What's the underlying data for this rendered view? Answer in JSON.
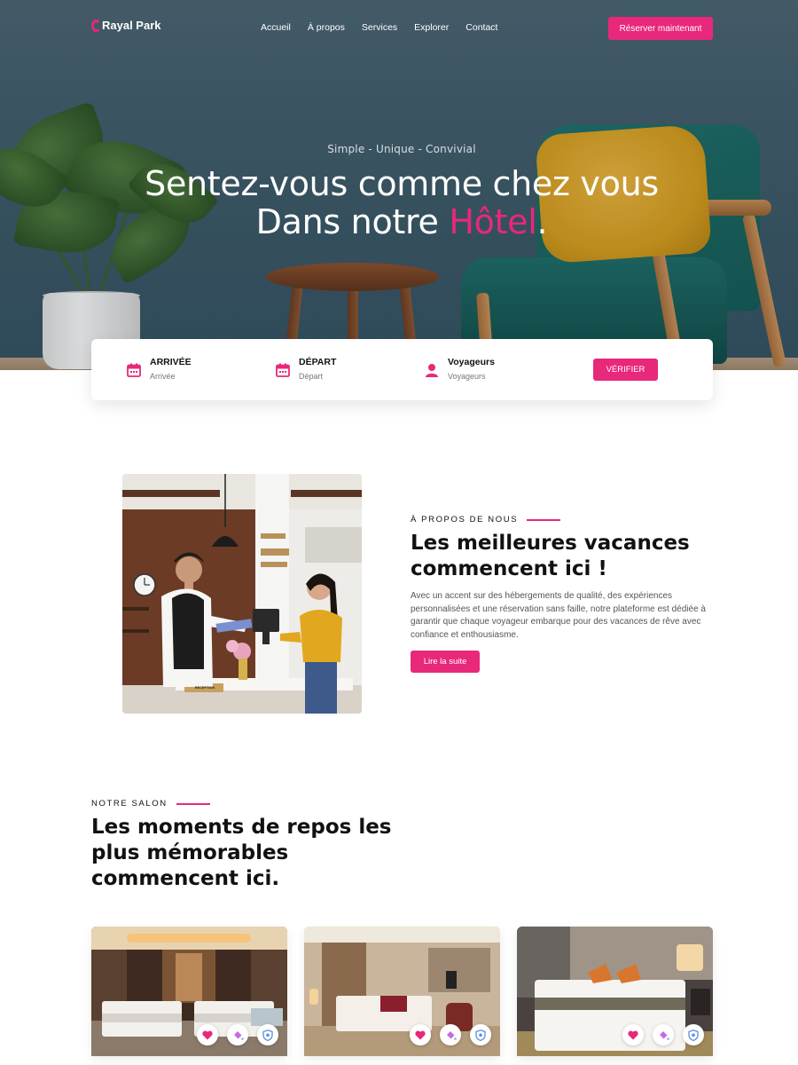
{
  "brand": {
    "name": "Rayal Park",
    "accent": "#e8287a"
  },
  "nav": {
    "links": [
      "Accueil",
      "À propos",
      "Services",
      "Explorer",
      "Contact"
    ],
    "cta": "Réserver maintenant"
  },
  "hero": {
    "tagline": "Simple - Unique - Convivial",
    "title_line1": "Sentez-vous comme chez vous",
    "title_line2_pre": "Dans notre ",
    "title_highlight": "Hôtel",
    "title_line2_post": "."
  },
  "booking": {
    "items": [
      {
        "label": "ARRIVÉE",
        "placeholder": "Arrivée",
        "icon": "calendar-icon"
      },
      {
        "label": "DÉPART",
        "placeholder": "Départ",
        "icon": "calendar-icon"
      },
      {
        "label": "Voyageurs",
        "placeholder": "Voyageurs",
        "icon": "user-icon"
      }
    ],
    "button": "VÉRIFIER"
  },
  "about": {
    "eyebrow": "À PROPOS DE NOUS",
    "title": "Les meilleures vacances commencent ici !",
    "text": "Avec un accent sur des hébergements de qualité, des expériences personnalisées et une réservation sans faille, notre plateforme est dédiée à garantir que chaque voyageur embarque pour des vacances de rêve avec confiance et enthousiasme.",
    "button": "Lire la suite",
    "signs": [
      "RECEPTION"
    ]
  },
  "salon": {
    "eyebrow": "NOTRE SALON",
    "title": "Les moments de repos les plus mémorables commencent ici.",
    "card_icons": [
      "heart-icon",
      "paint-bucket-icon",
      "shield-icon"
    ]
  }
}
